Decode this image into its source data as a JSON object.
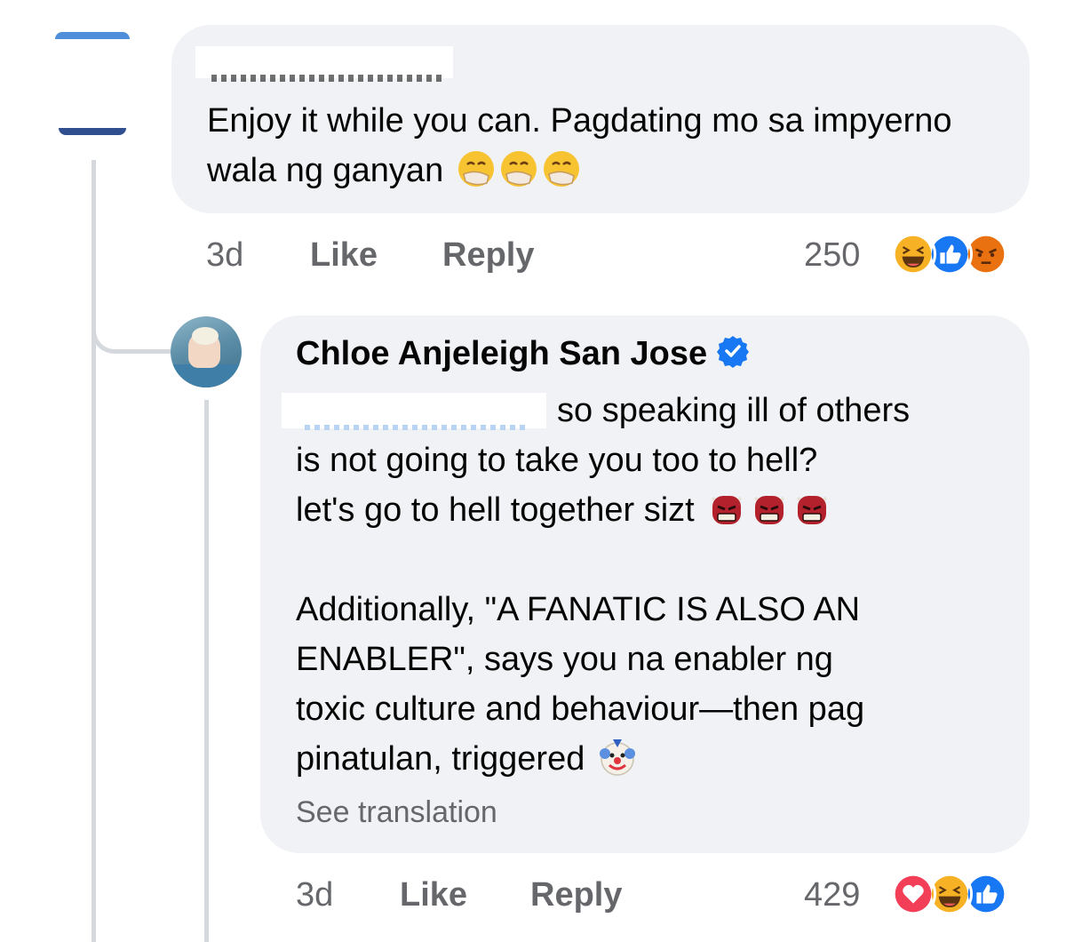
{
  "comment_1": {
    "author_redacted": true,
    "text": "Enjoy it while you can. Pagdating mo sa impyerno wala ng ganyan",
    "emoji": [
      "hand-over-mouth-emoji",
      "hand-over-mouth-emoji",
      "hand-over-mouth-emoji"
    ],
    "time": "3d",
    "like_label": "Like",
    "reply_label": "Reply",
    "reaction_count": "250",
    "reactions": [
      "haha-reaction",
      "like-reaction",
      "angry-reaction"
    ]
  },
  "comment_2": {
    "author": "Chloe Anjeleigh San Jose",
    "verified": true,
    "mention_redacted": true,
    "line1_after_mention": "so speaking ill of others",
    "line2": "is not going to take you too to hell?",
    "line3": "let's go to hell together sizt",
    "line3_emoji": [
      "ogre-emoji",
      "ogre-emoji",
      "ogre-emoji"
    ],
    "para2_line1": "Additionally, \"A FANATIC IS ALSO AN",
    "para2_line2": "ENABLER\", says you na enabler ng",
    "para2_line3": "toxic culture and behaviour—then pag",
    "para2_line4": "pinatulan, triggered",
    "para2_emoji": [
      "clown-emoji"
    ],
    "see_translation": "See translation",
    "time": "3d",
    "like_label": "Like",
    "reply_label": "Reply",
    "reaction_count": "429",
    "reactions": [
      "love-reaction",
      "haha-reaction",
      "like-reaction"
    ]
  },
  "colors": {
    "bubble": "#f0f2f5",
    "meta_text": "#65676b",
    "like_blue": "#1877f2",
    "love_red": "#f33e58",
    "haha_yellow": "#f7b125",
    "angry_orange": "#e9710f",
    "thread_line": "#d5d8dd"
  }
}
